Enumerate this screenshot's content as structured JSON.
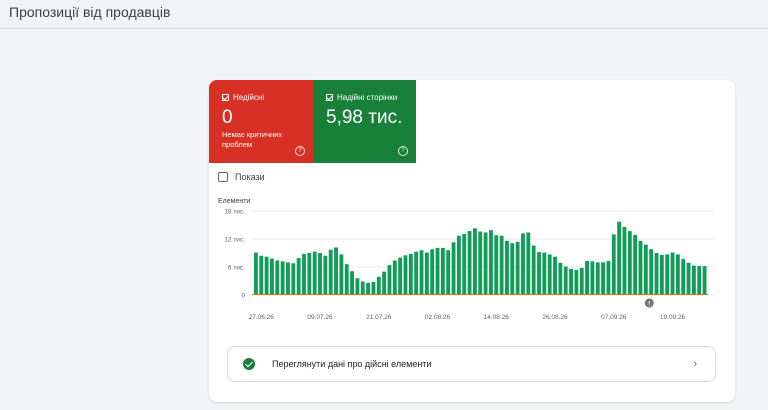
{
  "header": {
    "title": "Пропозиції від продавців"
  },
  "tiles": {
    "invalid": {
      "label": "Недійсні",
      "value": "0",
      "sub": "Немає критичних проблем",
      "help": "?"
    },
    "valid": {
      "label": "Надійні сторінки",
      "value": "5,98 тис.",
      "help": "?"
    }
  },
  "impressions": {
    "label": "Покази"
  },
  "details": {
    "label": "Переглянути дані про дійсні елементи",
    "chevron": "›"
  },
  "colors": {
    "invalid": "#d93025",
    "valid": "#188038",
    "bars": "#0f9d58",
    "baseline": "#e37400"
  },
  "icons": {
    "tile_checkbox": "checkbox-checked-icon",
    "help": "help-circle-icon",
    "details_status": "check-circle-icon",
    "details_arrow": "chevron-right-icon",
    "annotation": "annotation-marker-icon"
  },
  "chart_data": {
    "type": "bar",
    "ylabel": "Елементи",
    "y_ticks": [
      "18 тис.",
      "12 тис.",
      "6 тис.",
      "0"
    ],
    "ylim": [
      0,
      18000
    ],
    "x_tick_labels": [
      "27.06.26",
      "09.07.26",
      "21.07.26",
      "02.08.26",
      "14.08.26",
      "26.08.26",
      "07.09.26",
      "19.09.26"
    ],
    "annotation": "!",
    "grid": true,
    "values": [
      9100,
      8400,
      8200,
      7800,
      7400,
      7200,
      7000,
      6800,
      7900,
      8800,
      9000,
      9300,
      9000,
      8400,
      9700,
      10200,
      8700,
      6600,
      5100,
      3600,
      2900,
      2600,
      2800,
      3900,
      5000,
      6400,
      7400,
      8000,
      8500,
      8800,
      9300,
      9600,
      9100,
      9800,
      10100,
      10100,
      9600,
      11300,
      12700,
      13100,
      13700,
      14300,
      13600,
      13400,
      13900,
      12800,
      12700,
      11600,
      11100,
      11400,
      13200,
      13400,
      10600,
      9200,
      9100,
      8700,
      8200,
      6900,
      6100,
      5600,
      5400,
      5800,
      7300,
      7200,
      7000,
      7000,
      7300,
      13000,
      15700,
      14600,
      13700,
      12900,
      11600,
      10800,
      9800,
      9000,
      8600,
      8700,
      9100,
      8700,
      7700,
      6900,
      6300,
      6200,
      6200
    ]
  }
}
